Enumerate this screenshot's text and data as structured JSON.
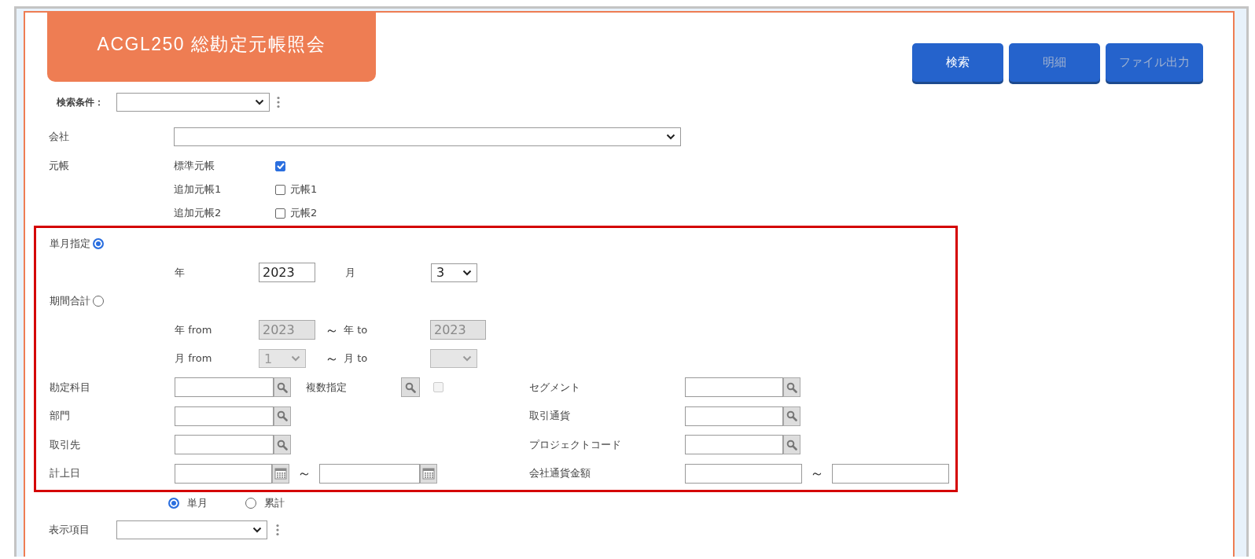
{
  "title": "ACGL250 総勘定元帳照会",
  "buttons": [
    {
      "label": "検索",
      "disabled": false
    },
    {
      "label": "明細",
      "disabled": true
    },
    {
      "label": "ファイル出力",
      "disabled": true
    }
  ],
  "search_condition": {
    "label": "検索条件："
  },
  "company": {
    "label": "会社"
  },
  "ledger": {
    "label": "元帳",
    "items": [
      {
        "label": "標準元帳",
        "checked": true
      },
      {
        "label": "追加元帳1",
        "checked": false,
        "option": "元帳1"
      },
      {
        "label": "追加元帳2",
        "checked": false,
        "option": "元帳2"
      }
    ]
  },
  "period_modes": [
    {
      "label": "単月指定",
      "selected": true
    },
    {
      "label": "期間合計",
      "selected": false
    }
  ],
  "single_month": {
    "year_label": "年",
    "year": "2023",
    "month_label": "月",
    "month": "3"
  },
  "range": {
    "disabled": true,
    "year_from_label": "年 from",
    "year_from": "2023",
    "year_separator": "～",
    "year_to_label": "年 to",
    "year_to": "2023",
    "month_from_label": "月 from",
    "month_from": "1",
    "month_separator": "～",
    "month_to_label": "月 to"
  },
  "multi": {
    "label": "複数指定",
    "checked": false,
    "disabled": true
  },
  "fields_left": [
    {
      "label": "勘定科目",
      "kind": "lookup"
    },
    {
      "label": "部門",
      "kind": "lookup"
    },
    {
      "label": "取引先",
      "kind": "lookup"
    },
    {
      "label": "計上日",
      "kind": "date_range",
      "separator": "～"
    }
  ],
  "fields_right": [
    {
      "label": "セグメント",
      "kind": "lookup"
    },
    {
      "label": "取引通貨",
      "kind": "lookup"
    },
    {
      "label": "プロジェクトコード",
      "kind": "lookup"
    },
    {
      "label": "会社通貨金額",
      "kind": "range",
      "separator": "～"
    }
  ],
  "aggregation": [
    {
      "label": "単月",
      "selected": true
    },
    {
      "label": "累計",
      "selected": false
    }
  ],
  "display_items": {
    "label": "表示項目"
  }
}
